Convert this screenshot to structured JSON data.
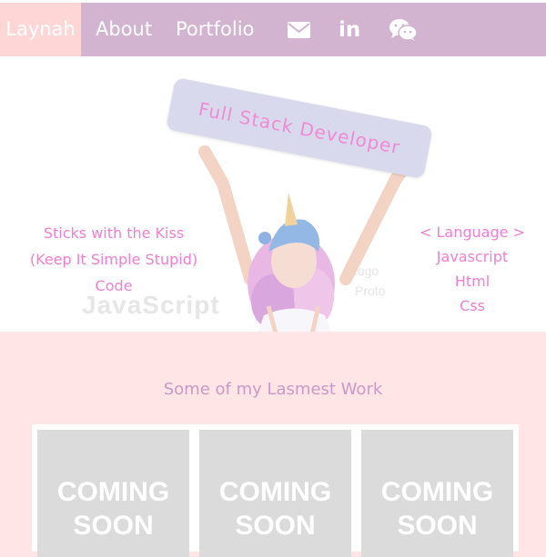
{
  "nav": {
    "brand": "Laynah",
    "links": [
      "About",
      "Portfolio"
    ],
    "icons": [
      "mail-icon",
      "linkedin-icon",
      "wechat-icon"
    ],
    "linkedin_glyph": "in"
  },
  "hero": {
    "sign_text": "Full Stack Developer",
    "left_lines": [
      "Sticks with the Kiss",
      "(Keep It Simple Stupid)",
      "Code"
    ],
    "right_lines": [
      "< Language >",
      "Javascript",
      "Html",
      "Css"
    ],
    "background_text": [
      "JavaScript",
      "Logo",
      "Proto"
    ]
  },
  "work": {
    "title": "Some of my Lasmest Work",
    "cards": [
      {
        "line1": "COMING",
        "line2": "SOON"
      },
      {
        "line1": "COMING",
        "line2": "SOON"
      },
      {
        "line1": "COMING",
        "line2": "SOON"
      }
    ]
  },
  "colors": {
    "nav_bg": "#d2b3d0",
    "brand_bg": "#ffd6d6",
    "page_bg": "#ffe5e5",
    "accent_pink": "#f07fd0",
    "title_purple": "#c99ac7",
    "card_grey": "#dbdbdb"
  }
}
